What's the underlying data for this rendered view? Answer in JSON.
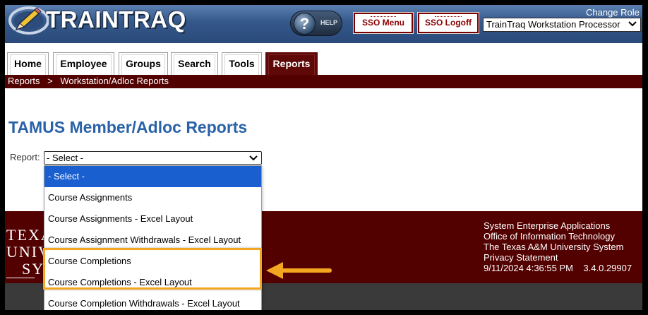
{
  "header": {
    "app_name": "TRAINTRAQ",
    "help_label": "HELP",
    "sso_menu_label": "SSO Menu",
    "sso_logoff_label": "SSO Logoff",
    "change_role_label": "Change Role",
    "role_selected": "TrainTraq Workstation Processor"
  },
  "tabs": [
    {
      "label": "Home",
      "active": false
    },
    {
      "label": "Employee",
      "active": false
    },
    {
      "label": "Groups",
      "active": false
    },
    {
      "label": "Search",
      "active": false
    },
    {
      "label": "Tools",
      "active": false
    },
    {
      "label": "Reports",
      "active": true
    }
  ],
  "breadcrumb": {
    "items": [
      "Reports",
      ">",
      "Workstation/Adloc Reports"
    ]
  },
  "main": {
    "title": "TAMUS Member/Adloc Reports",
    "report_label": "Report:",
    "report_selected": "- Select -",
    "report_options": [
      "- Select -",
      "Course Assignments",
      "Course Assignments - Excel Layout",
      "Course Assignment Withdrawals - Excel Layout",
      "Course Completions",
      "Course Completions - Excel Layout",
      "Course Completion Withdrawals - Excel Layout"
    ]
  },
  "footer": {
    "logo_lines": [
      "TEXA",
      "UNIV",
      "SY"
    ],
    "info_lines": [
      "System Enterprise Applications",
      "Office of Information Technology",
      "The Texas A&M University System",
      "Privacy Statement"
    ],
    "timestamp": "9/11/2024 4:36:55 PM",
    "version": "3.4.0.29907"
  },
  "colors": {
    "header_blue": "#34588a",
    "maroon": "#520000",
    "title_blue": "#2a62a8",
    "highlight_orange": "#f3a61f",
    "selected_option": "#1a5fd0"
  },
  "icons": {
    "logo": "pencil-logo-icon",
    "help": "question-mark-icon",
    "select": "chevron-down-icon",
    "callout": "arrow-left-icon"
  }
}
